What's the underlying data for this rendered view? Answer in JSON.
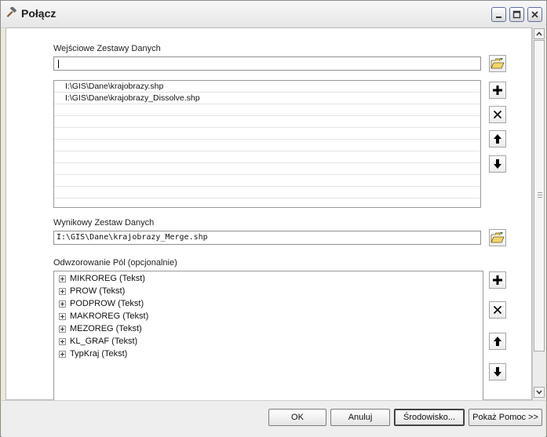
{
  "window": {
    "title": "Połącz",
    "icon": "hammer-icon"
  },
  "input_datasets": {
    "label": "Wejściowe Zestawy Danych",
    "value": "",
    "items": [
      "I:\\GIS\\Dane\\krajobrazy.shp",
      "I:\\GIS\\Dane\\krajobrazy_Dissolve.shp"
    ]
  },
  "output_dataset": {
    "label": "Wynikowy Zestaw Danych",
    "value": "I:\\GIS\\Dane\\krajobrazy_Merge.shp"
  },
  "field_mapping": {
    "label": "Odwzorowanie Pól (opcjonalnie)",
    "fields": [
      "MIKROREG (Tekst)",
      "PROW (Tekst)",
      "PODPROW (Tekst)",
      "MAKROREG (Tekst)",
      "MEZOREG (Tekst)",
      "KL_GRAF (Tekst)",
      "TypKraj (Tekst)"
    ]
  },
  "buttons": {
    "ok": "OK",
    "cancel": "Anuluj",
    "environment": "Środowisko...",
    "show_help": "Pokaż Pomoc >>"
  }
}
